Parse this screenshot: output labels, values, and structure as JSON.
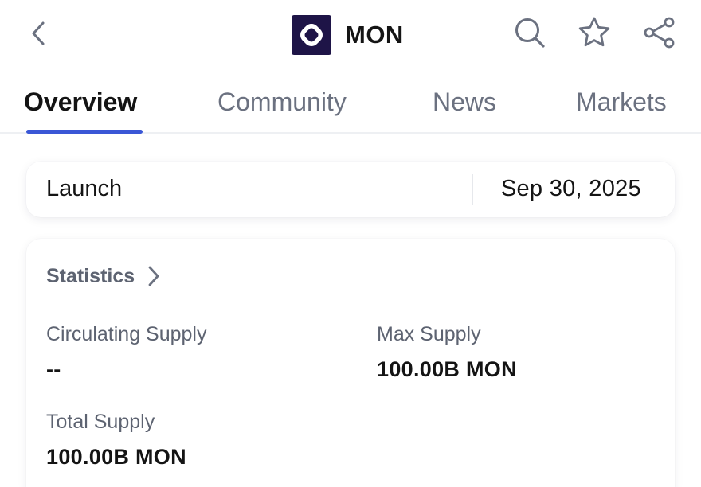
{
  "header": {
    "title": "MON",
    "icons": {
      "back": "chevron-left-icon",
      "search": "search-icon",
      "favorite": "star-icon",
      "share": "share-icon"
    },
    "logo_color": "#1e1447"
  },
  "tabs": [
    {
      "label": "Overview",
      "active": true
    },
    {
      "label": "Community",
      "active": false
    },
    {
      "label": "News",
      "active": false
    },
    {
      "label": "Markets",
      "active": false
    }
  ],
  "accent_color": "#3a57d6",
  "launch": {
    "label": "Launch",
    "date": "Sep 30, 2025"
  },
  "statistics": {
    "title": "Statistics",
    "circulating_supply": {
      "label": "Circulating Supply",
      "value": "--"
    },
    "max_supply": {
      "label": "Max Supply",
      "value": "100.00B MON"
    },
    "total_supply": {
      "label": "Total Supply",
      "value": "100.00B MON"
    }
  }
}
